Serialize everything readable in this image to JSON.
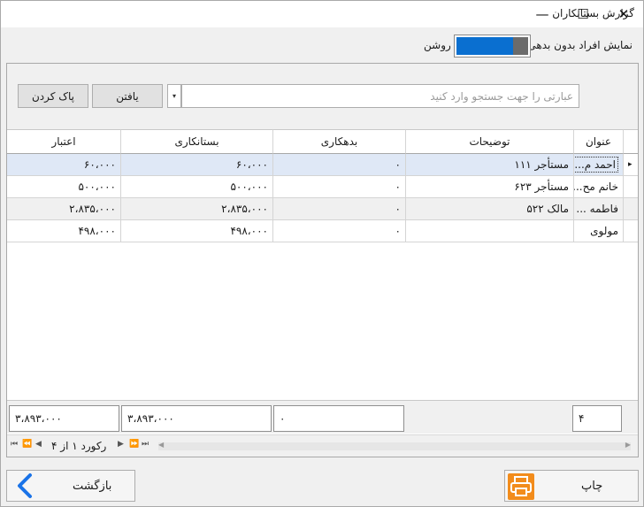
{
  "window": {
    "title": "گزارش بستانکاران",
    "minimize": "—",
    "maximize": "☐",
    "close": "✕"
  },
  "toggle": {
    "label": "نمایش افراد بدون بدهی",
    "state_text": "روشن",
    "on": true
  },
  "search": {
    "placeholder": "عبارتی را جهت جستجو وارد کنید",
    "find_label": "یافتن",
    "clear_label": "پاک کردن",
    "dropdown_glyph": "▾"
  },
  "grid": {
    "columns": [
      "عنوان",
      "توضیحات",
      "بدهکاری",
      "بستانکاری",
      "اعتبار"
    ],
    "rows": [
      {
        "title": "احمد م...",
        "desc": "مستأجر ۱۱۱",
        "debit": "۰",
        "credit": "۶۰،۰۰۰",
        "balance": "۶۰،۰۰۰"
      },
      {
        "title": "خانم مح...",
        "desc": "مستأجر ۶۲۳",
        "debit": "۰",
        "credit": "۵۰۰،۰۰۰",
        "balance": "۵۰۰،۰۰۰"
      },
      {
        "title": "فاطمه ...",
        "desc": "مالک ۵۲۲",
        "debit": "۰",
        "credit": "۲،۸۳۵،۰۰۰",
        "balance": "۲،۸۳۵،۰۰۰"
      },
      {
        "title": "مولوی",
        "desc": "",
        "debit": "۰",
        "credit": "۴۹۸،۰۰۰",
        "balance": "۴۹۸،۰۰۰"
      }
    ],
    "row_indicator": "▸"
  },
  "totals": {
    "count": "۴",
    "debit": "۰",
    "credit": "۳،۸۹۳،۰۰۰",
    "balance": "۳،۸۹۳،۰۰۰"
  },
  "navigator": {
    "first": "⏮",
    "prev_page": "⏪",
    "prev": "◀",
    "record_text": "رکورد ۱ از ۴",
    "next": "▶",
    "next_page": "⏩",
    "last": "⏭"
  },
  "buttons": {
    "back_label": "بازگشت",
    "print_label": "چاپ"
  },
  "icons": {
    "back": "chevron-left-icon",
    "print": "printer-icon"
  },
  "colors": {
    "toggle_on": "#0a6fd0",
    "print_icon_bg": "#f28c1c",
    "back_icon": "#1a73e8",
    "selected_row": "#dfe8f6"
  }
}
